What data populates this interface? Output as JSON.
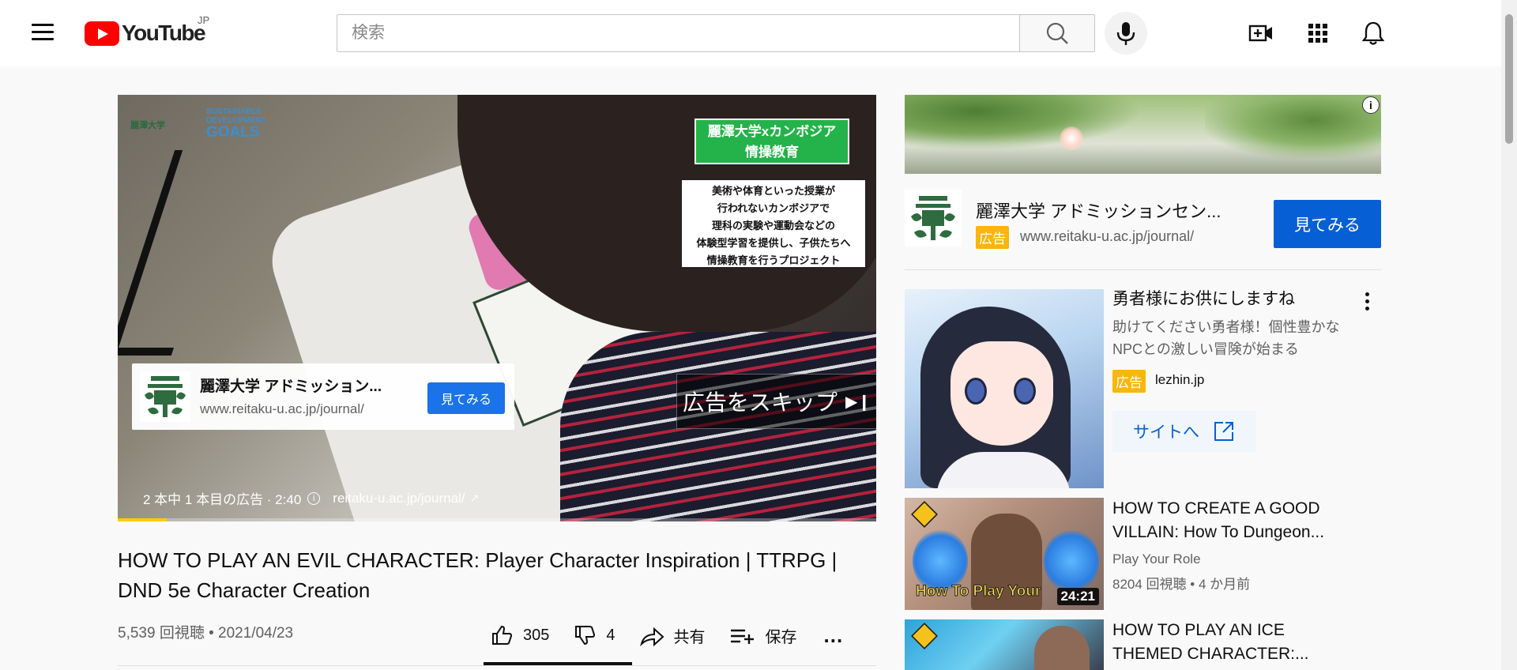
{
  "header": {
    "logo_text": "YouTube",
    "region": "JP",
    "search_placeholder": "検索"
  },
  "player": {
    "overlay_headline_line1": "麗澤大学xカンボジア",
    "overlay_headline_line2": "情操教育",
    "overlay_text_lines": [
      "美術や体育といった授業が",
      "行われないカンボジアで",
      "理科の実験や運動会などの",
      "体験型学習を提供し、子供たちへ",
      "情操教育を行うプロジェクト"
    ],
    "corner_logo_text": "麗澤大学",
    "sdg_small": "SUSTAINABLE DEVELOPMENT",
    "sdg_big": "GOALS",
    "ad_card": {
      "title": "麗澤大学 アドミッション...",
      "url": "www.reitaku-u.ac.jp/journal/",
      "cta": "見てみる"
    },
    "skip_label": "広告をスキップ",
    "ad_info_text": "2 本中 1 本目の広告 · 2:40",
    "ad_info_url": "reitaku-u.ac.jp/journal/",
    "progress_fraction": 0.065
  },
  "video": {
    "title": "HOW TO PLAY AN EVIL CHARACTER: Player Character Inspiration | TTRPG | DND 5e Character Creation",
    "views_date": "5,539 回視聴 • 2021/04/23",
    "likes": "305",
    "dislikes": "4",
    "share_label": "共有",
    "save_label": "保存",
    "more_label": "..."
  },
  "sidebar": {
    "ad_company": {
      "title": "麗澤大学 アドミッションセン...",
      "badge": "広告",
      "url": "www.reitaku-u.ac.jp/journal/",
      "cta": "見てみる"
    },
    "ad_item": {
      "title": "勇者様にお供にしますね",
      "description": "助けてください勇者様！個性豊かなNPCとの激しい冒険が始まる",
      "badge": "広告",
      "domain": "lezhin.jp",
      "site_button": "サイトへ"
    },
    "videos": [
      {
        "title": "HOW TO CREATE A GOOD VILLAIN: How To Dungeon...",
        "channel": "Play Your Role",
        "meta": "8204 回視聴 • 4 か月前",
        "duration": "24:21",
        "thumb_caption": "How To Play Your"
      },
      {
        "title": "HOW TO PLAY AN ICE THEMED CHARACTER:..."
      }
    ]
  },
  "colors": {
    "youtube_red": "#ff0000",
    "ad_badge": "#f9b60b",
    "cta_blue": "#065fd4",
    "ad_progress": "#ffcc00"
  }
}
